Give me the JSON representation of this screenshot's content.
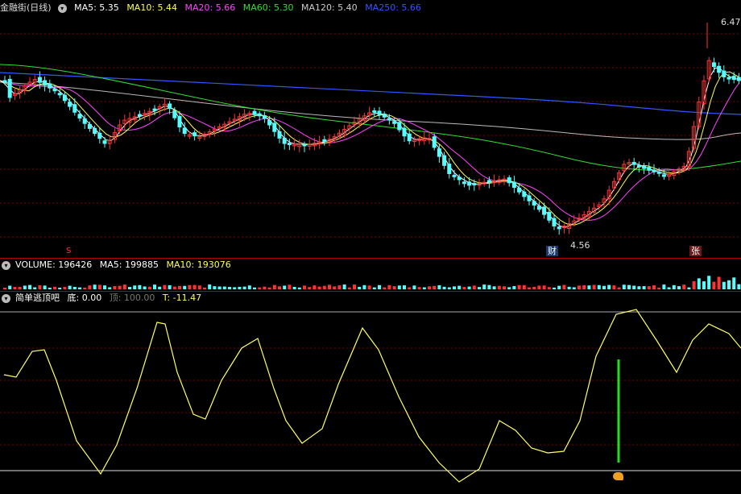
{
  "main": {
    "title": "金融街(日线)",
    "ma": [
      {
        "label": "MA5: 5.35",
        "color": "#ffffff"
      },
      {
        "label": "MA10: 5.44",
        "color": "#ffff55"
      },
      {
        "label": "MA20: 5.66",
        "color": "#ff44ff"
      },
      {
        "label": "MA60: 5.30",
        "color": "#33dd33"
      },
      {
        "label": "MA120: 5.40",
        "color": "#cccccc"
      },
      {
        "label": "MA250: 5.66",
        "color": "#3355ff"
      }
    ],
    "high_label": "6.47",
    "low_label": "4.56",
    "marker_s": "S",
    "marker_cai": "财",
    "marker_zhang": "张"
  },
  "volume": {
    "label": "VOLUME: 196426",
    "ma5": "MA5: 199885",
    "ma10": "MA10: 193076",
    "colors": {
      "label": "#ffffff",
      "ma5": "#ffffff",
      "ma10": "#ffff55"
    }
  },
  "indicator": {
    "name": "简单逃顶吧",
    "bottom": "底: 0.00",
    "top": "顶: 100.00",
    "t": "T: -11.47",
    "colors": {
      "bottom": "#ffffff",
      "top": "#777777",
      "t": "#ffff55"
    }
  },
  "colors": {
    "up": "#ff3333",
    "down": "#55ffff",
    "grid": "#800000",
    "osc": "#ffff66",
    "signal": "#22dd22"
  }
}
